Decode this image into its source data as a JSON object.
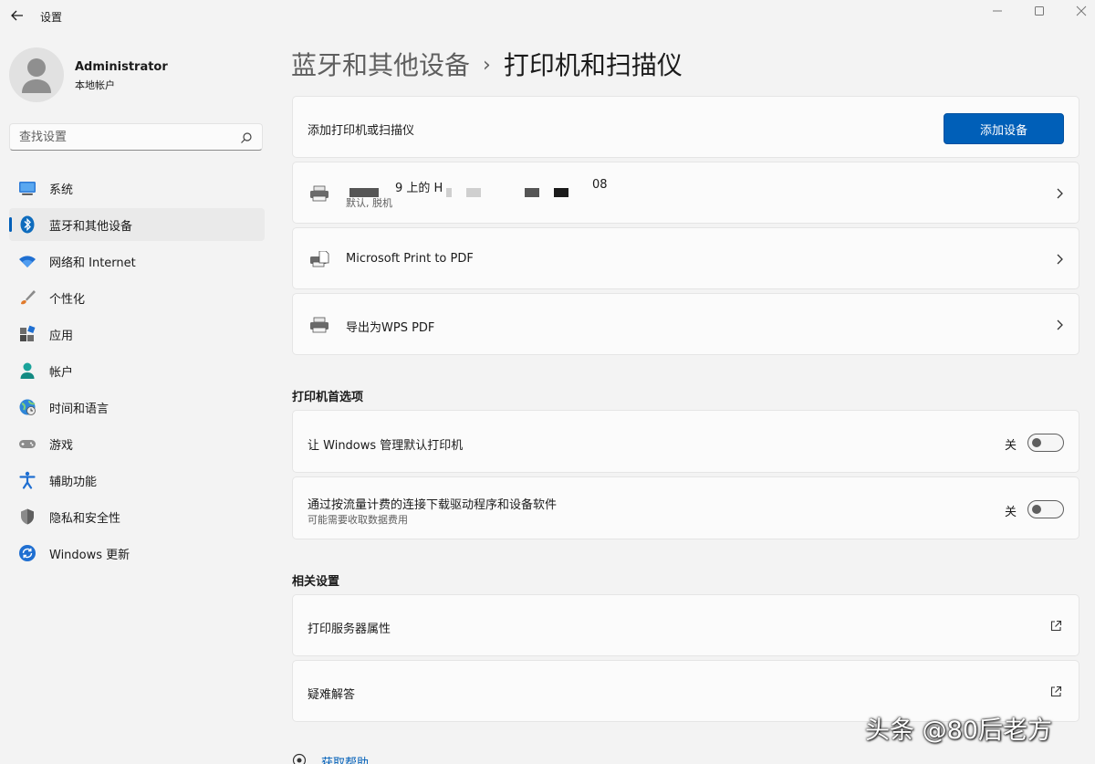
{
  "window": {
    "title": "设置",
    "controls": [
      "minimize-icon",
      "maximize-icon",
      "close-icon"
    ]
  },
  "user": {
    "name": "Administrator",
    "account_type": "本地帐户"
  },
  "search": {
    "placeholder": "查找设置"
  },
  "sidebar": {
    "items": [
      {
        "label": "系统",
        "icon": "system-icon",
        "active": false
      },
      {
        "label": "蓝牙和其他设备",
        "icon": "bluetooth-icon",
        "active": true
      },
      {
        "label": "网络和 Internet",
        "icon": "wifi-icon",
        "active": false
      },
      {
        "label": "个性化",
        "icon": "brush-icon",
        "active": false
      },
      {
        "label": "应用",
        "icon": "apps-icon",
        "active": false
      },
      {
        "label": "帐户",
        "icon": "account-icon",
        "active": false
      },
      {
        "label": "时间和语言",
        "icon": "globe-clock-icon",
        "active": false
      },
      {
        "label": "游戏",
        "icon": "gamepad-icon",
        "active": false
      },
      {
        "label": "辅助功能",
        "icon": "accessibility-icon",
        "active": false
      },
      {
        "label": "隐私和安全性",
        "icon": "shield-icon",
        "active": false
      },
      {
        "label": "Windows 更新",
        "icon": "update-icon",
        "active": false
      }
    ]
  },
  "breadcrumb": {
    "parent": "蓝牙和其他设备",
    "separator": "›",
    "current": "打印机和扫描仪"
  },
  "add_printer": {
    "label": "添加打印机或扫描仪",
    "button": "添加设备"
  },
  "printers": [
    {
      "name_prefix": "9 上的 H",
      "name_suffix": "08",
      "status": "默认, 脱机",
      "redacted": true
    },
    {
      "name": "Microsoft Print to PDF"
    },
    {
      "name": "导出为WPS PDF"
    }
  ],
  "preferences": {
    "title": "打印机首选项",
    "items": [
      {
        "label": "让 Windows 管理默认打印机",
        "state": "关",
        "on": false
      },
      {
        "label": "通过按流量计费的连接下载驱动程序和设备软件",
        "sub": "可能需要收取数据费用",
        "state": "关",
        "on": false
      }
    ]
  },
  "related": {
    "title": "相关设置",
    "items": [
      {
        "label": "打印服务器属性",
        "icon": "external-link-icon"
      },
      {
        "label": "疑难解答",
        "icon": "external-link-icon"
      }
    ]
  },
  "help": {
    "label": "获取帮助"
  },
  "watermark": "头条 @80后老方",
  "colors": {
    "accent": "#005fb8",
    "background": "#f3f3f3",
    "card": "#fbfbfb"
  }
}
